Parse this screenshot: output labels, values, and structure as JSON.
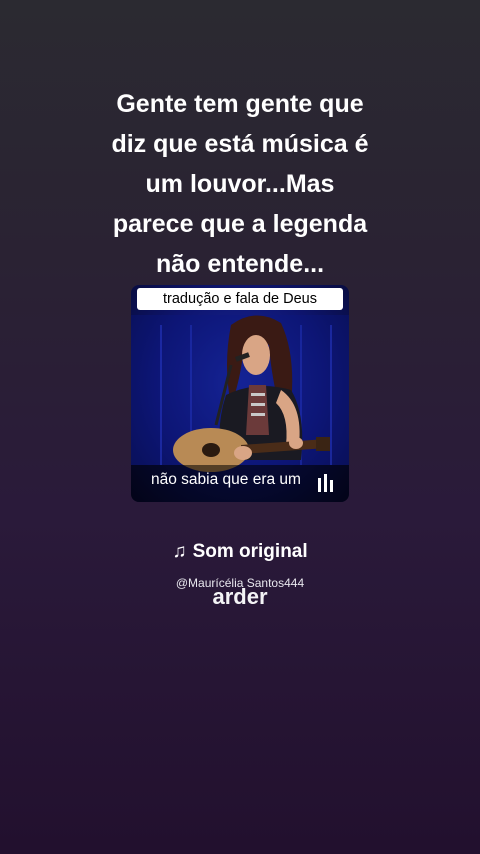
{
  "post": {
    "caption_lines": [
      "Gente tem gente que",
      "diz que está música é",
      "um louvor...Mas",
      "parece que a legenda",
      "não entende..."
    ]
  },
  "video": {
    "top_label": "tradução  e fala de Deus",
    "bottom_subtitle": "não sabia que era um"
  },
  "audio": {
    "icon": "music-note-icon",
    "title": "Som original",
    "author": "@Maurícélia Santos444",
    "lyric_word": "arder"
  }
}
